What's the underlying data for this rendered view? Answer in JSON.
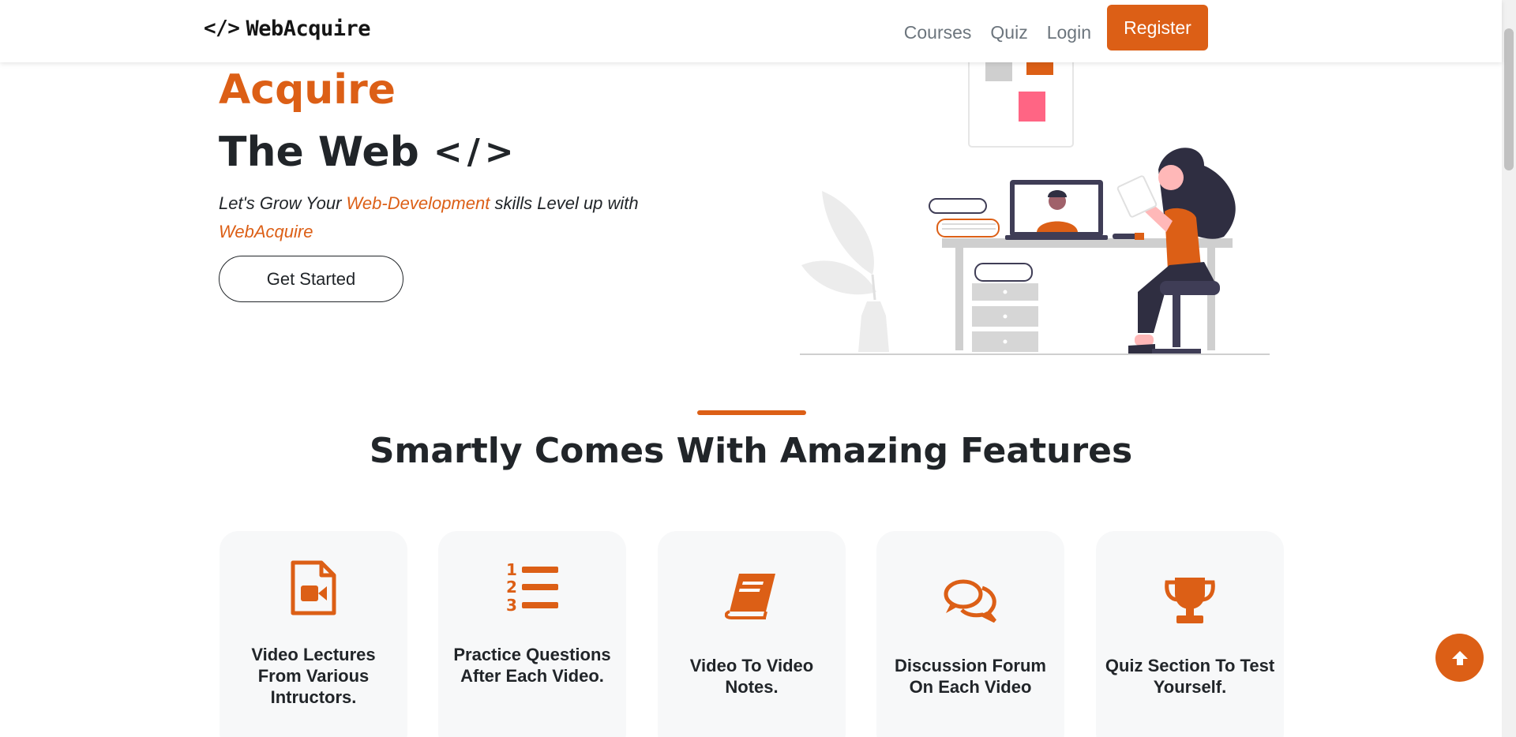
{
  "nav": {
    "brand_code": "</>",
    "brand_name": "WebAcquire",
    "links": [
      "Courses",
      "Quiz",
      "Login"
    ],
    "register": "Register"
  },
  "hero": {
    "title_1": "Acquire",
    "title_2": "The Web",
    "title_2_glyph": "</>",
    "sub_1": "Let's Grow Your ",
    "sub_accent_1": "Web-Development",
    "sub_2": " skills Level up with ",
    "sub_accent_2": "WebAcquire",
    "cta": "Get Started"
  },
  "features": {
    "title": "Smartly Comes With Amazing Features",
    "cards": [
      {
        "icon": "file-video-icon",
        "label": "Video Lectures From Various Intructors."
      },
      {
        "icon": "list-ol-icon",
        "label": "Practice Questions After Each Video."
      },
      {
        "icon": "book-icon",
        "label": "Video To Video Notes."
      },
      {
        "icon": "comments-icon",
        "label": "Discussion Forum On Each Video"
      },
      {
        "icon": "trophy-icon",
        "label": "Quiz Section To Test Yourself."
      }
    ]
  },
  "colors": {
    "accent": "#dc5f16",
    "text": "#212529",
    "muted": "#6c757d",
    "card_bg": "#f7f8f9"
  }
}
